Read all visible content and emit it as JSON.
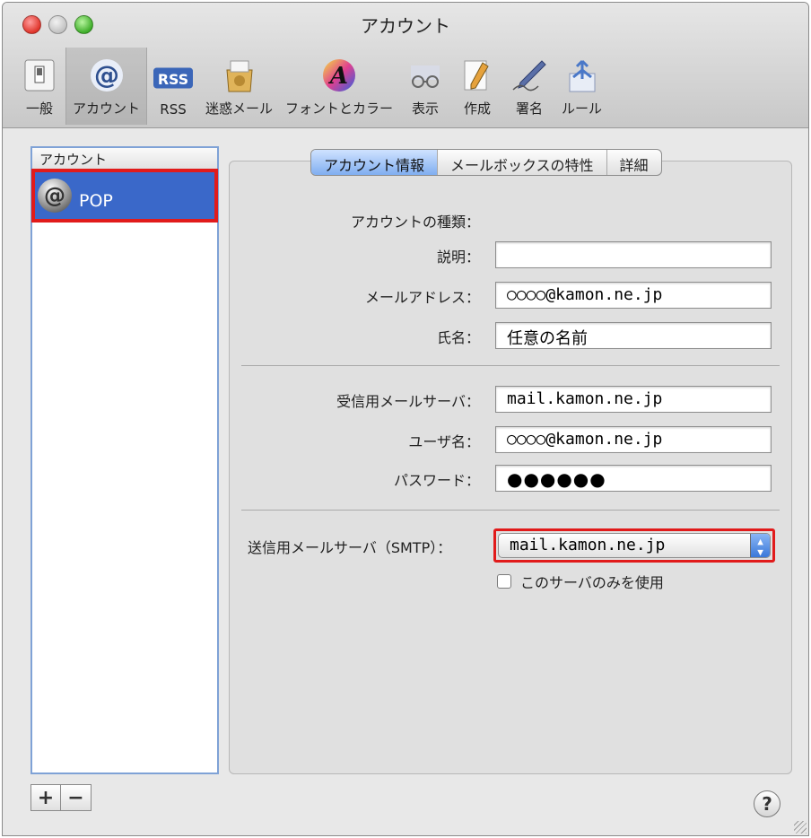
{
  "window": {
    "title": "アカウント"
  },
  "toolbar": {
    "items": [
      {
        "label": "一般",
        "icon": "switch-icon"
      },
      {
        "label": "アカウント",
        "icon": "at-sign-icon"
      },
      {
        "label": "RSS",
        "icon": "rss-icon"
      },
      {
        "label": "迷惑メール",
        "icon": "junk-mail-icon"
      },
      {
        "label": "フォントとカラー",
        "icon": "font-color-icon"
      },
      {
        "label": "表示",
        "icon": "glasses-icon"
      },
      {
        "label": "作成",
        "icon": "pencil-icon"
      },
      {
        "label": "署名",
        "icon": "signature-pen-icon"
      },
      {
        "label": "ルール",
        "icon": "rules-arrows-icon"
      }
    ],
    "rss_badge": "RSS"
  },
  "sidebar": {
    "header": "アカウント",
    "items": [
      {
        "name": "POP",
        "icon": "at-sign-icon"
      }
    ],
    "add_label": "+",
    "remove_label": "−"
  },
  "tabs": [
    "アカウント情報",
    "メールボックスの特性",
    "詳細"
  ],
  "form": {
    "account_type_label": "アカウントの種類：",
    "description_label": "説明：",
    "description_value": "",
    "email_label": "メールアドレス：",
    "email_value": "○○○○@kamon.ne.jp",
    "fullname_label": "氏名：",
    "fullname_value": "任意の名前",
    "incoming_server_label": "受信用メールサーバ：",
    "incoming_server_value": "mail.kamon.ne.jp",
    "username_label": "ユーザ名：",
    "username_value": "○○○○@kamon.ne.jp",
    "password_label": "パスワード：",
    "password_value": "●●●●●●",
    "smtp_label": "送信用メールサーバ（SMTP）：",
    "smtp_value": "mail.kamon.ne.jp",
    "only_this_server_label": "このサーバのみを使用"
  },
  "help_label": "?",
  "colors": {
    "highlight": "#e11b1b",
    "selection": "#3a68c9"
  }
}
